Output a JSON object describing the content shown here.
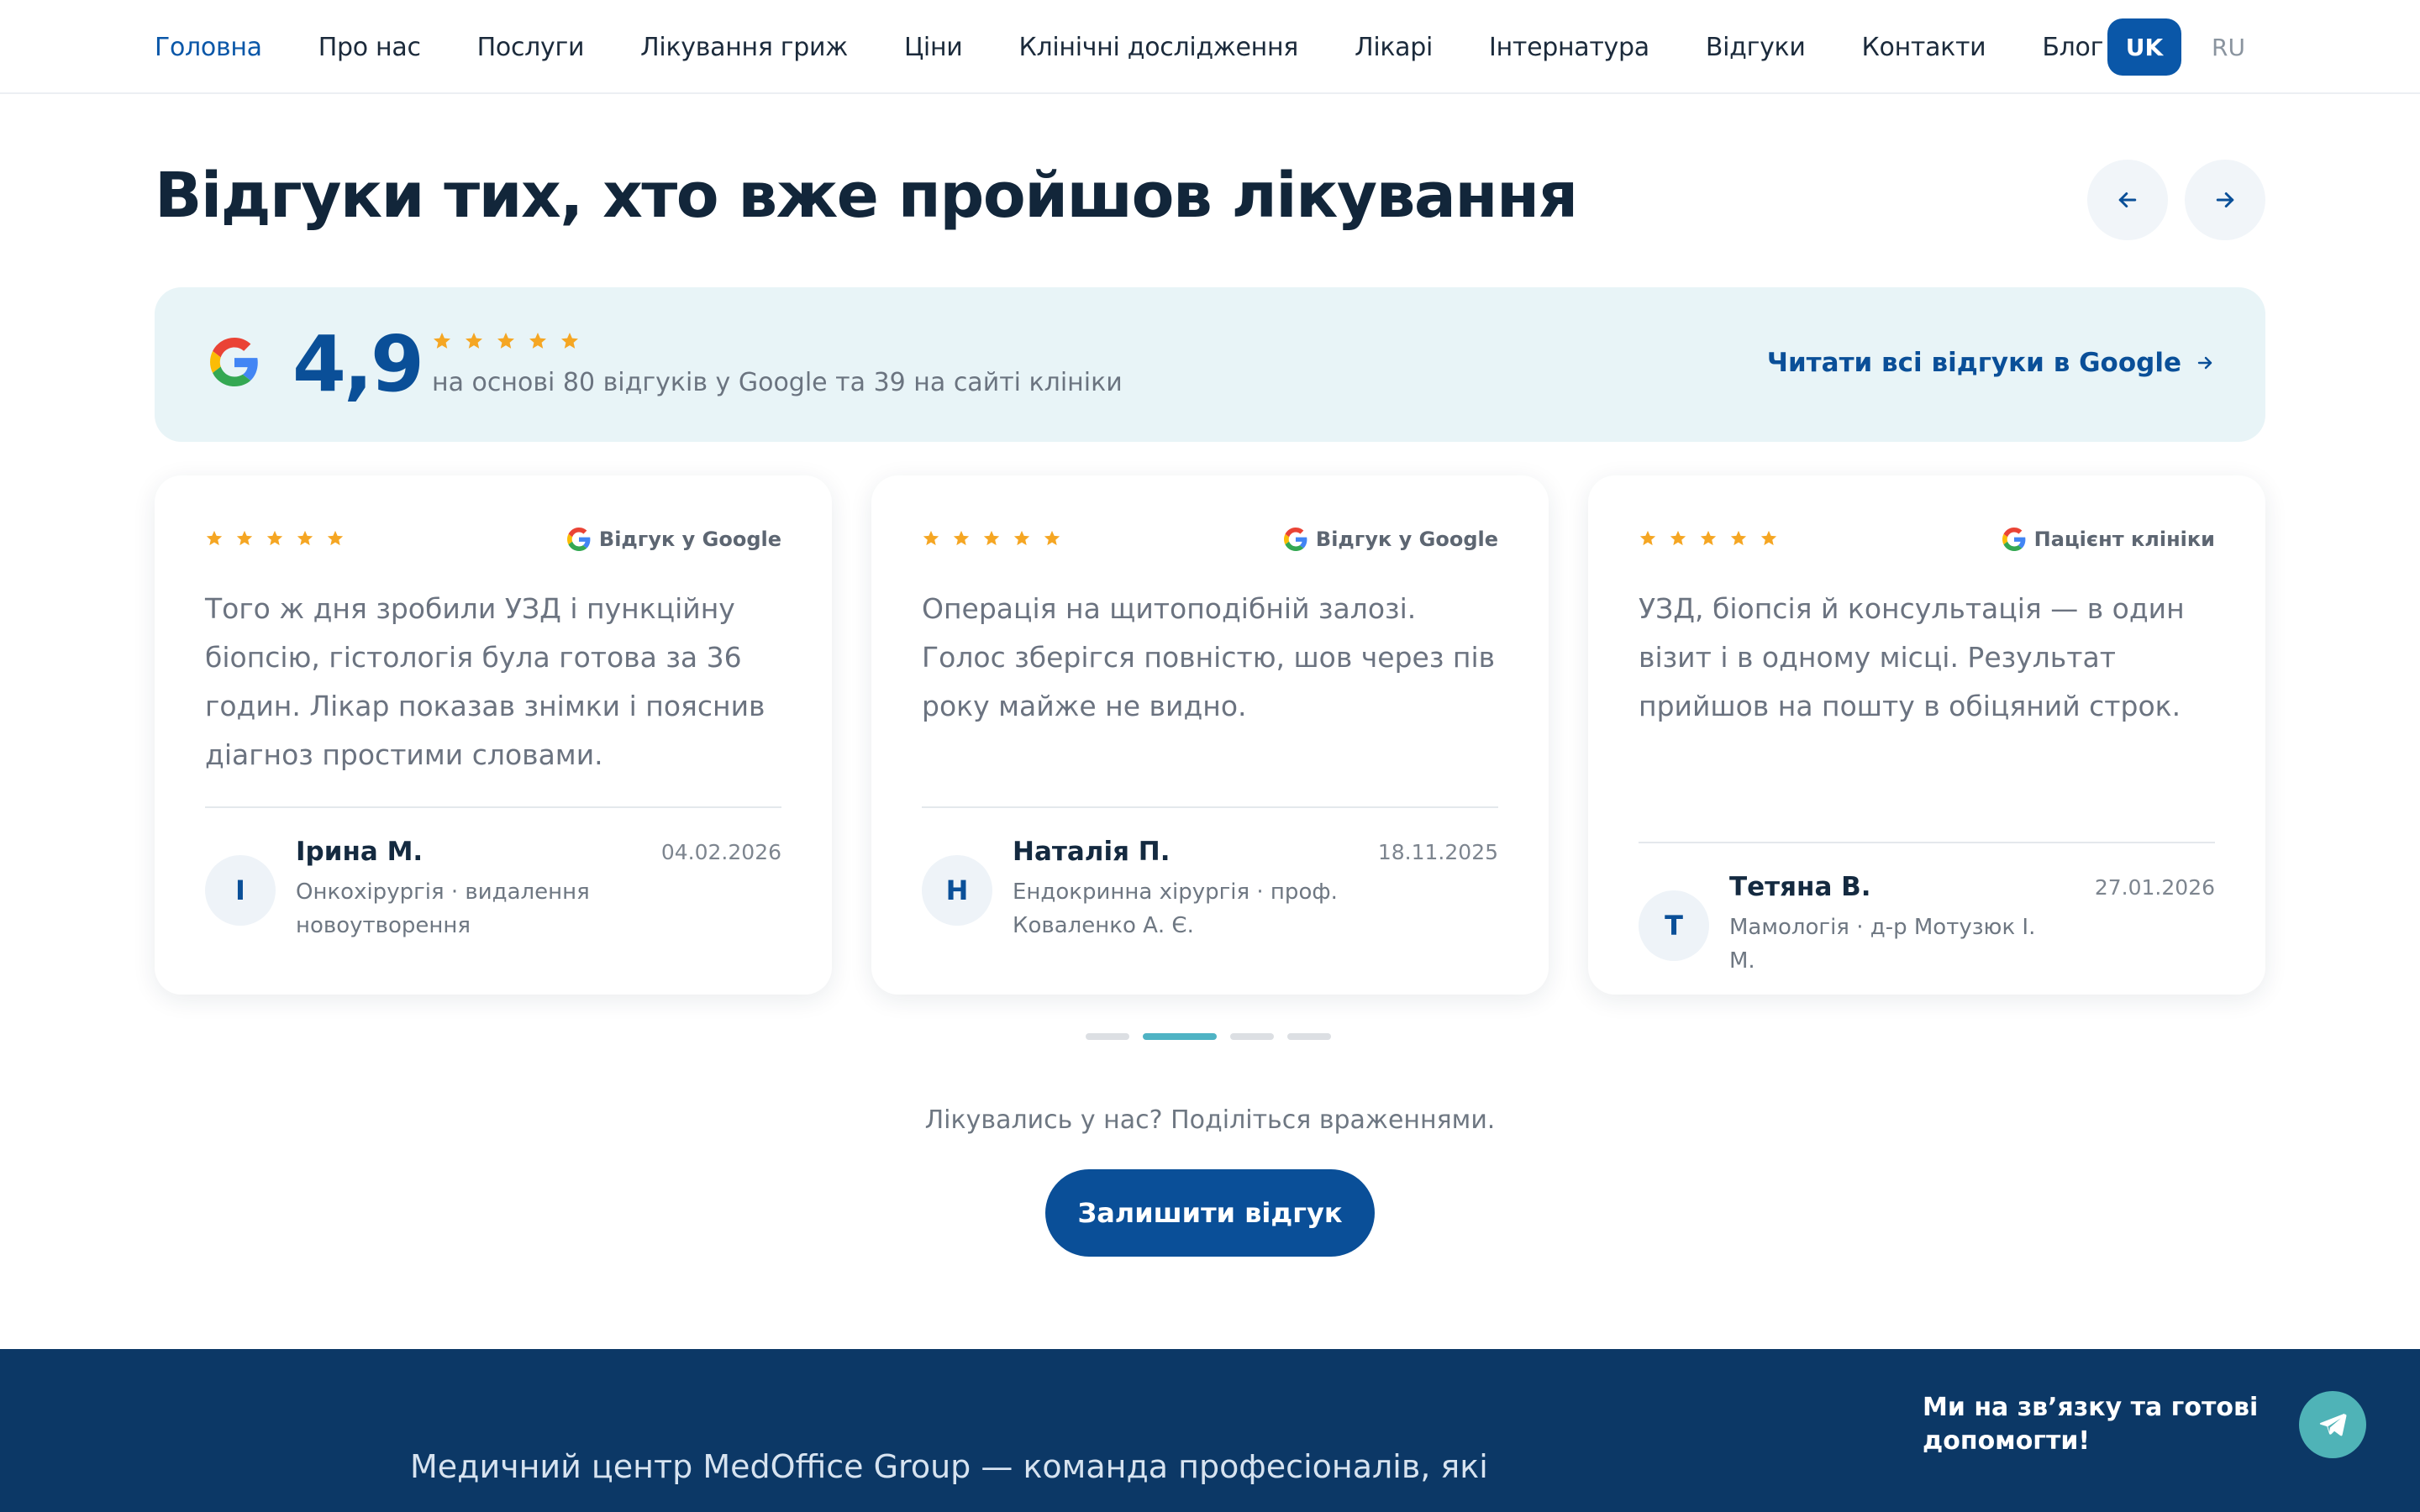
{
  "nav": {
    "items": [
      {
        "label": "Головна",
        "active": true
      },
      {
        "label": "Про нас"
      },
      {
        "label": "Послуги"
      },
      {
        "label": "Лікування гриж"
      },
      {
        "label": "Ціни"
      },
      {
        "label": "Клінічні дослідження"
      },
      {
        "label": "Лікарі"
      },
      {
        "label": "Інтернатура"
      },
      {
        "label": "Відгуки"
      },
      {
        "label": "Контакти"
      },
      {
        "label": "Блог"
      }
    ],
    "languages": [
      {
        "label": "UK",
        "active": true
      },
      {
        "label": "RU"
      }
    ]
  },
  "section": {
    "title": "Відгуки тих, хто вже пройшов лікування"
  },
  "rating": {
    "value": "4,9",
    "stars": 5,
    "caption": "на основі 80 відгуків у Google та 39 на сайті клініки",
    "link_label": "Читати всі відгуки в Google"
  },
  "reviews": [
    {
      "stars": 5,
      "source_label": "Відгук у Google",
      "text": "Того ж дня зробили УЗД і пункційну біопсію, гістологія була готова за 36 годин. Лікар показав знімки і пояснив діагноз простими словами.",
      "initial": "І",
      "name": "Ірина М.",
      "meta": "Онкохірургія · видалення новоутворення",
      "date": "04.02.2026"
    },
    {
      "stars": 5,
      "source_label": "Відгук у Google",
      "text": "Операція на щитоподібній залозі. Голос зберігся повністю, шов через пів року майже не видно.",
      "initial": "Н",
      "name": "Наталія П.",
      "meta": "Ендокринна хірургія · проф. Коваленко А. Є.",
      "date": "18.11.2025"
    },
    {
      "stars": 5,
      "source_label": "Пацієнт клініки",
      "text": "УЗД, біопсія й консультація — в один візит і в одному місці. Результат прийшов на пошту в обіцяний строк.",
      "initial": "Т",
      "name": "Тетяна В.",
      "meta": "Мамологія · д-р Мотузюк І. М.",
      "date": "27.01.2026"
    }
  ],
  "pagination": {
    "count": 4,
    "active_index": 1
  },
  "cta": {
    "text": "Лікувались у нас? Поділіться враженнями.",
    "button_label": "Залишити відгук"
  },
  "footer": {
    "text": "Медичний центр MedOffice Group — команда професіоналів, які",
    "contact_text": "Ми на зв’язку та готові допомогти!"
  },
  "colors": {
    "primary": "#0a57a8",
    "star": "#f5a623",
    "accent_teal": "#4fb3c4",
    "footer_bg": "#0c3866"
  },
  "icons": {
    "prev": "arrow-left-icon",
    "next": "arrow-right-icon",
    "google": "google-g-icon",
    "star": "star-icon",
    "telegram": "telegram-icon"
  }
}
